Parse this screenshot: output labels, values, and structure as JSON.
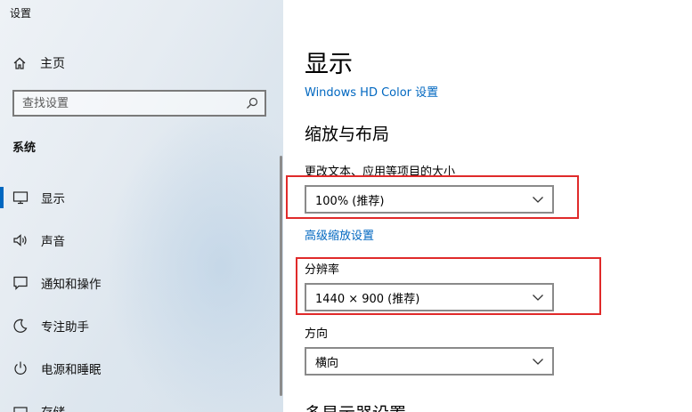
{
  "window": {
    "title": "设置"
  },
  "sidebar": {
    "home_label": "主页",
    "search_placeholder": "查找设置",
    "section": "系统",
    "items": [
      {
        "label": "显示",
        "icon": "monitor-icon",
        "selected": true
      },
      {
        "label": "声音",
        "icon": "speaker-icon"
      },
      {
        "label": "通知和操作",
        "icon": "notification-icon"
      },
      {
        "label": "专注助手",
        "icon": "moon-icon"
      },
      {
        "label": "电源和睡眠",
        "icon": "power-icon"
      },
      {
        "label": "存储",
        "icon": "storage-icon"
      }
    ]
  },
  "main": {
    "title": "显示",
    "hd_color_link": "Windows HD Color 设置",
    "scale_section": "缩放与布局",
    "scale_label": "更改文本、应用等项目的大小",
    "scale_value": "100% (推荐)",
    "advanced_scale_link": "高级缩放设置",
    "resolution_label": "分辨率",
    "resolution_value": "1440 × 900 (推荐)",
    "orientation_label": "方向",
    "orientation_value": "横向",
    "multi_display_section": "多显示器设置"
  },
  "colors": {
    "accent": "#0067c0",
    "highlight": "#e02a2a"
  }
}
